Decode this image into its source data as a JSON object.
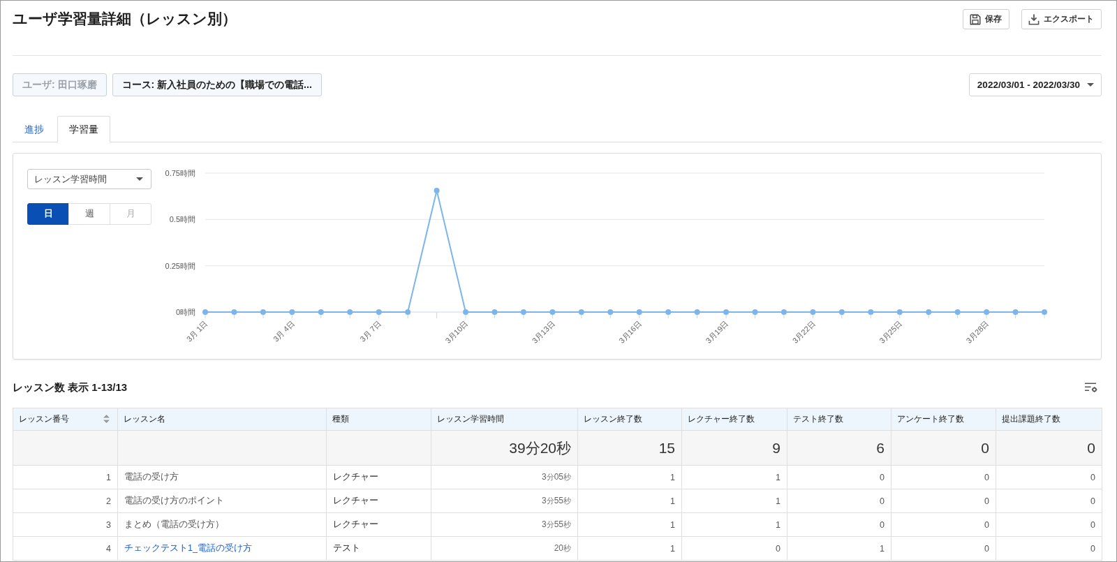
{
  "page": {
    "title": "ユーザ学習量詳細（レッスン別）"
  },
  "actions": [
    {
      "kind": "save",
      "label": "保存"
    },
    {
      "kind": "export",
      "label": "エクスポート"
    }
  ],
  "filters": {
    "chips": [
      {
        "label": "ユーザ: 田口琢磨",
        "disabled": true
      },
      {
        "label": "コース: 新入社員のための【職場での電話...",
        "disabled": false
      }
    ],
    "date_range": {
      "value": "2022/03/01 - 2022/03/30"
    }
  },
  "tabs": [
    {
      "label": "進捗",
      "selected": false
    },
    {
      "label": "学習量",
      "selected": true
    }
  ],
  "chart_panel": {
    "metric_select": {
      "value": "レッスン学習時間"
    },
    "periods": [
      {
        "label": "日",
        "selected": true,
        "disabled": false
      },
      {
        "label": "週",
        "selected": false,
        "disabled": false
      },
      {
        "label": "月",
        "selected": false,
        "disabled": true
      }
    ],
    "chart_data": {
      "type": "line",
      "categories": [
        "3月 1日",
        null,
        null,
        "3月 4日",
        null,
        null,
        "3月 7日",
        null,
        null,
        "3月10日",
        null,
        null,
        "3月13日",
        null,
        null,
        "3月16日",
        null,
        null,
        "3月19日",
        null,
        null,
        "3月22日",
        null,
        null,
        "3月25日",
        null,
        null,
        "3月28日",
        null,
        null
      ],
      "series": [
        {
          "color": "#7cb5ec",
          "marker": true,
          "values": [
            0,
            0,
            0,
            0,
            0,
            0,
            0,
            0,
            0.656,
            0,
            0,
            0,
            0,
            0,
            0,
            0,
            0,
            0,
            0,
            0,
            0,
            0,
            0,
            0,
            0,
            0,
            0,
            0,
            0,
            0
          ]
        }
      ],
      "ylim": [
        0,
        0.75
      ],
      "yticks": [
        {
          "value": 0,
          "label": "0時間"
        },
        {
          "value": 0.25,
          "label": "0.25時間"
        },
        {
          "value": 0.5,
          "label": "0.5時間"
        },
        {
          "value": 0.75,
          "label": "0.75時間"
        }
      ]
    }
  },
  "table": {
    "title": "レッスン数 表示 1-13/13",
    "columns": [
      {
        "label": "レッスン番号",
        "sortable": true
      },
      {
        "label": "レッスン名",
        "sortable": false
      },
      {
        "label": "種類",
        "sortable": false
      },
      {
        "label": "レッスン学習時間",
        "sortable": false
      },
      {
        "label": "レッスン終了数",
        "sortable": false
      },
      {
        "label": "レクチャー終了数",
        "sortable": false
      },
      {
        "label": "テスト終了数",
        "sortable": false
      },
      {
        "label": "アンケート終了数",
        "sortable": false
      },
      {
        "label": "提出課題終了数",
        "sortable": false
      }
    ],
    "totals": {
      "study_time": "39分20秒",
      "lessons": "15",
      "lectures": "9",
      "tests": "6",
      "surveys": "0",
      "assignments": "0"
    },
    "rows": [
      {
        "number": "1",
        "name": "電話の受け方",
        "link": false,
        "type": "レクチャー",
        "study_time": "3分05秒",
        "lessons": "1",
        "lectures": "1",
        "tests": "0",
        "surveys": "0",
        "assignments": "0"
      },
      {
        "number": "2",
        "name": "電話の受け方のポイント",
        "link": false,
        "type": "レクチャー",
        "study_time": "3分55秒",
        "lessons": "1",
        "lectures": "1",
        "tests": "0",
        "surveys": "0",
        "assignments": "0"
      },
      {
        "number": "3",
        "name": "まとめ（電話の受け方）",
        "link": false,
        "type": "レクチャー",
        "study_time": "3分55秒",
        "lessons": "1",
        "lectures": "1",
        "tests": "0",
        "surveys": "0",
        "assignments": "0"
      },
      {
        "number": "4",
        "name": "チェックテスト1_電話の受け方",
        "link": true,
        "type": "テスト",
        "study_time": "20秒",
        "lessons": "1",
        "lectures": "0",
        "tests": "1",
        "surveys": "0",
        "assignments": "0"
      }
    ]
  }
}
